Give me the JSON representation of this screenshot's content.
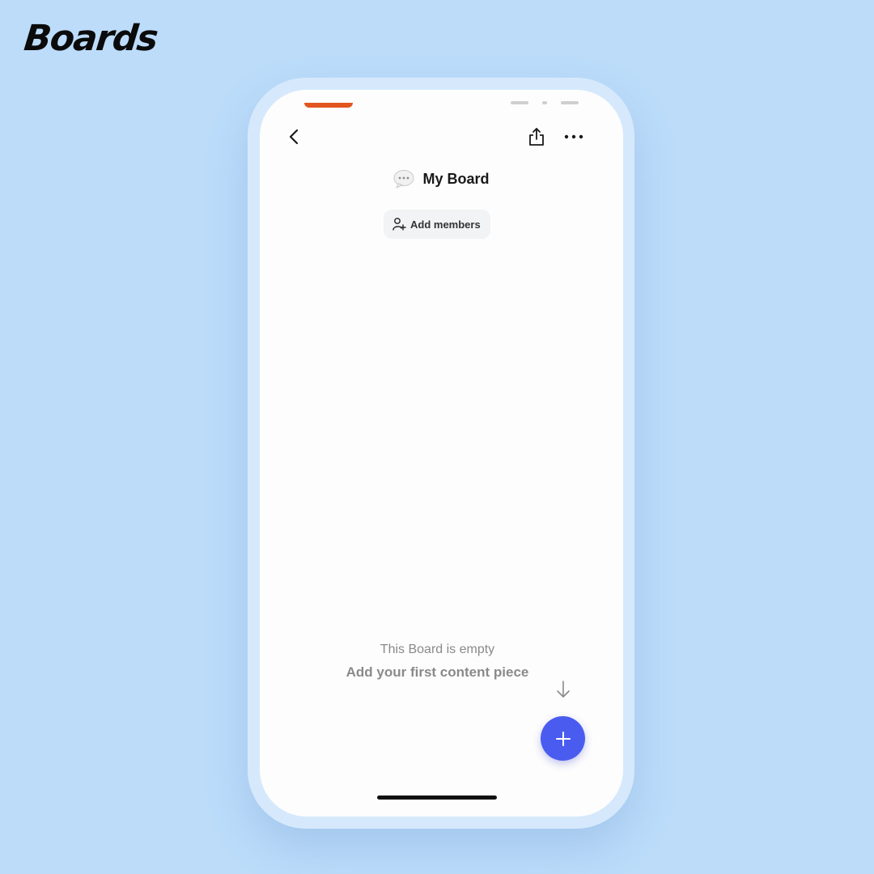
{
  "brand": {
    "name": "Boards"
  },
  "header": {
    "back_icon": "chevron-left-icon",
    "share_icon": "share-icon",
    "more_icon": "more-horizontal-icon"
  },
  "board": {
    "emoji_icon": "speech-bubble-icon",
    "title": "My Board",
    "add_members_label": "Add members",
    "add_members_icon": "add-person-icon"
  },
  "empty_state": {
    "title": "This Board is empty",
    "subtitle": "Add your first content piece",
    "arrow_icon": "arrow-down-icon"
  },
  "fab": {
    "icon": "plus-icon"
  },
  "colors": {
    "background": "#BCDCFA",
    "frame": "#D6E9FC",
    "accent": "#4A5CF0",
    "status_accent": "#E2561F"
  }
}
